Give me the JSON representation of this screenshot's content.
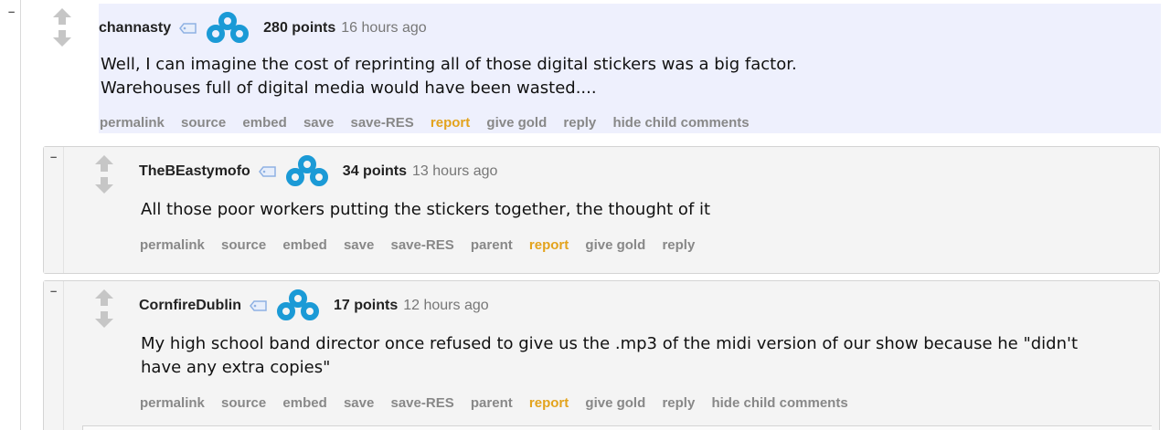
{
  "comments": [
    {
      "collapse": "–",
      "author": "channasty",
      "score": "280 points",
      "time": "16 hours ago",
      "text_lines": [
        "Well, I can imagine the cost of reprinting all of those digital stickers was a big factor.",
        "Warehouses full of digital media would have been wasted...."
      ],
      "buttons": [
        "permalink",
        "source",
        "embed",
        "save",
        "save-RES",
        "report",
        "give gold",
        "reply",
        "hide child comments"
      ]
    },
    {
      "collapse": "–",
      "author": "TheBEastymofo",
      "score": "34 points",
      "time": "13 hours ago",
      "text_lines": [
        "All those poor workers putting the stickers together, the thought of it"
      ],
      "buttons": [
        "permalink",
        "source",
        "embed",
        "save",
        "save-RES",
        "parent",
        "report",
        "give gold",
        "reply"
      ]
    },
    {
      "collapse": "–",
      "author": "CornfireDublin",
      "score": "17 points",
      "time": "12 hours ago",
      "text_lines": [
        "My high school band director once refused to give us the .mp3 of the midi version of our show because he \"didn't",
        "have any extra copies\""
      ],
      "buttons": [
        "permalink",
        "source",
        "embed",
        "save",
        "save-RES",
        "parent",
        "report",
        "give gold",
        "reply",
        "hide child comments"
      ]
    }
  ],
  "icons": {
    "upvote": "upvote-arrow-icon",
    "downvote": "downvote-arrow-icon",
    "tag": "user-tag-icon",
    "flair": "cloud9-flair-icon"
  },
  "colors": {
    "highlight_bg": "#eef0fd",
    "nested_bg": "#f4f4f4",
    "report": "#e3a31d",
    "button_gray": "#888888",
    "flair_blue": "#1b9ad6"
  }
}
